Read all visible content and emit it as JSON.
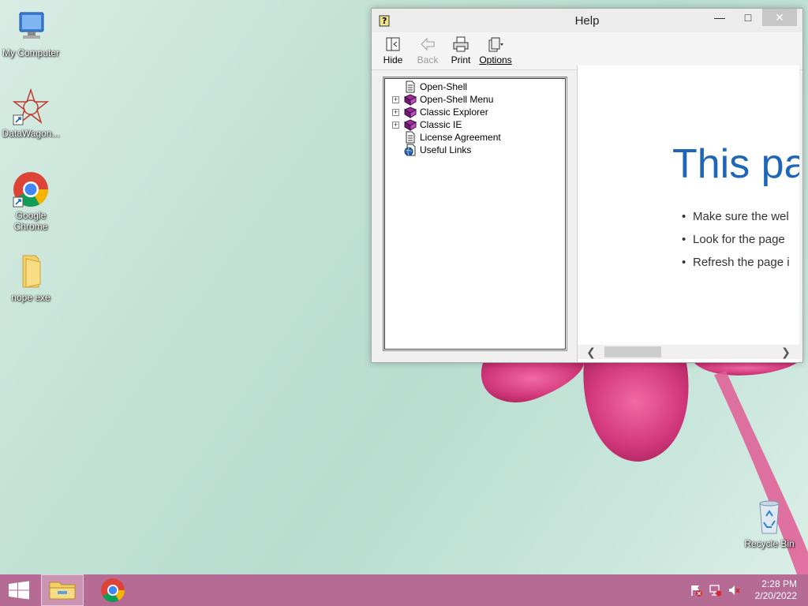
{
  "desktop": {
    "icons": [
      {
        "label": "My Computer"
      },
      {
        "label": "DataWagon..."
      },
      {
        "label": "Google Chrome"
      },
      {
        "label": "nope exe"
      },
      {
        "label": "Recycle Bin"
      }
    ]
  },
  "help_window": {
    "title": "Help",
    "toolbar": {
      "hide": "Hide",
      "back": "Back",
      "print": "Print",
      "options": "Options"
    },
    "tree": [
      {
        "label": "Open-Shell",
        "expandable": false,
        "icon": "page-icon"
      },
      {
        "label": "Open-Shell Menu",
        "expandable": true,
        "icon": "book-icon"
      },
      {
        "label": "Classic Explorer",
        "expandable": true,
        "icon": "book-icon"
      },
      {
        "label": "Classic IE",
        "expandable": true,
        "icon": "book-icon"
      },
      {
        "label": "License Agreement",
        "expandable": false,
        "icon": "page-icon"
      },
      {
        "label": "Useful Links",
        "expandable": false,
        "icon": "globe-page-icon"
      }
    ],
    "content": {
      "heading": "This pag",
      "bullets": [
        "Make sure the wel",
        "Look for the page",
        "Refresh the page i"
      ]
    }
  },
  "taskbar": {
    "time": "2:28 PM",
    "date": "2/20/2022"
  },
  "colors": {
    "taskbar": "#b66b95",
    "heading_blue": "#1e66b8",
    "flower_pink": "#d43a7e"
  }
}
